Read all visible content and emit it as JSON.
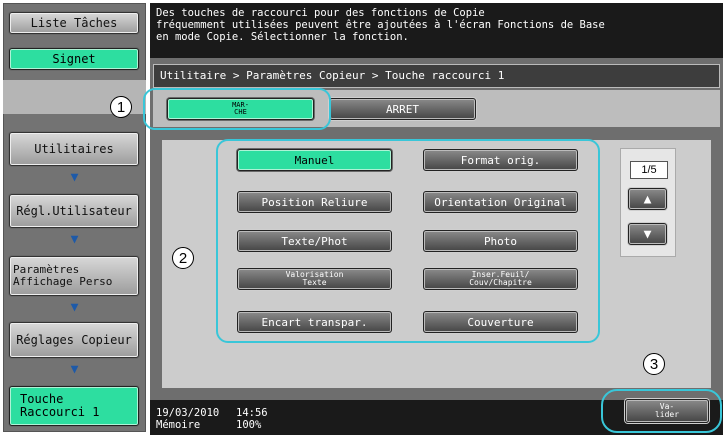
{
  "left_panel": {
    "liste_taches": "Liste Tâches",
    "signet": "Signet",
    "nav": [
      {
        "label": "Utilitaires"
      },
      {
        "label": "Régl.Utilisateur"
      },
      {
        "label": "Paramètres\nAffichage Perso"
      },
      {
        "label": "Réglages Copieur"
      },
      {
        "label": "Touche\nRaccourci 1"
      }
    ]
  },
  "message": "Des touches de raccourci pour des fonctions de Copie\nfréquemment utilisées peuvent être ajoutées à l'écran Fonctions de Base\nen mode Copie. Sélectionner la fonction.",
  "breadcrumb": "Utilitaire > Paramètres Copieur > Touche raccourci 1",
  "toggle": {
    "on": "MAR-\nCHE",
    "off": "ARRET"
  },
  "functions": [
    {
      "label": "Manuel",
      "selected": true
    },
    {
      "label": "Format orig.",
      "selected": false
    },
    {
      "label": "Position Reliure",
      "selected": false
    },
    {
      "label": "Orientation Original",
      "selected": false
    },
    {
      "label": "Texte/Phot",
      "selected": false
    },
    {
      "label": "Photo",
      "selected": false
    },
    {
      "label": "Valorisation\nTexte",
      "selected": false
    },
    {
      "label": "Inser.Feuil/\nCouv/Chapitre",
      "selected": false
    },
    {
      "label": "Encart transpar.",
      "selected": false
    },
    {
      "label": "Couverture",
      "selected": false
    }
  ],
  "pager": {
    "page": "1/5",
    "up_icon": "arrow-up-icon",
    "down_icon": "arrow-down-icon"
  },
  "status": {
    "date": "19/03/2010",
    "time": "14:56",
    "memory_label": "Mémoire",
    "memory_value": "100%"
  },
  "validate": "Va-\nlider",
  "callouts": [
    "1",
    "2",
    "3"
  ],
  "colors": {
    "accent_green": "#2ddea0",
    "callout_cyan": "#39c6d8",
    "dark_bg": "#1a1a1a"
  }
}
